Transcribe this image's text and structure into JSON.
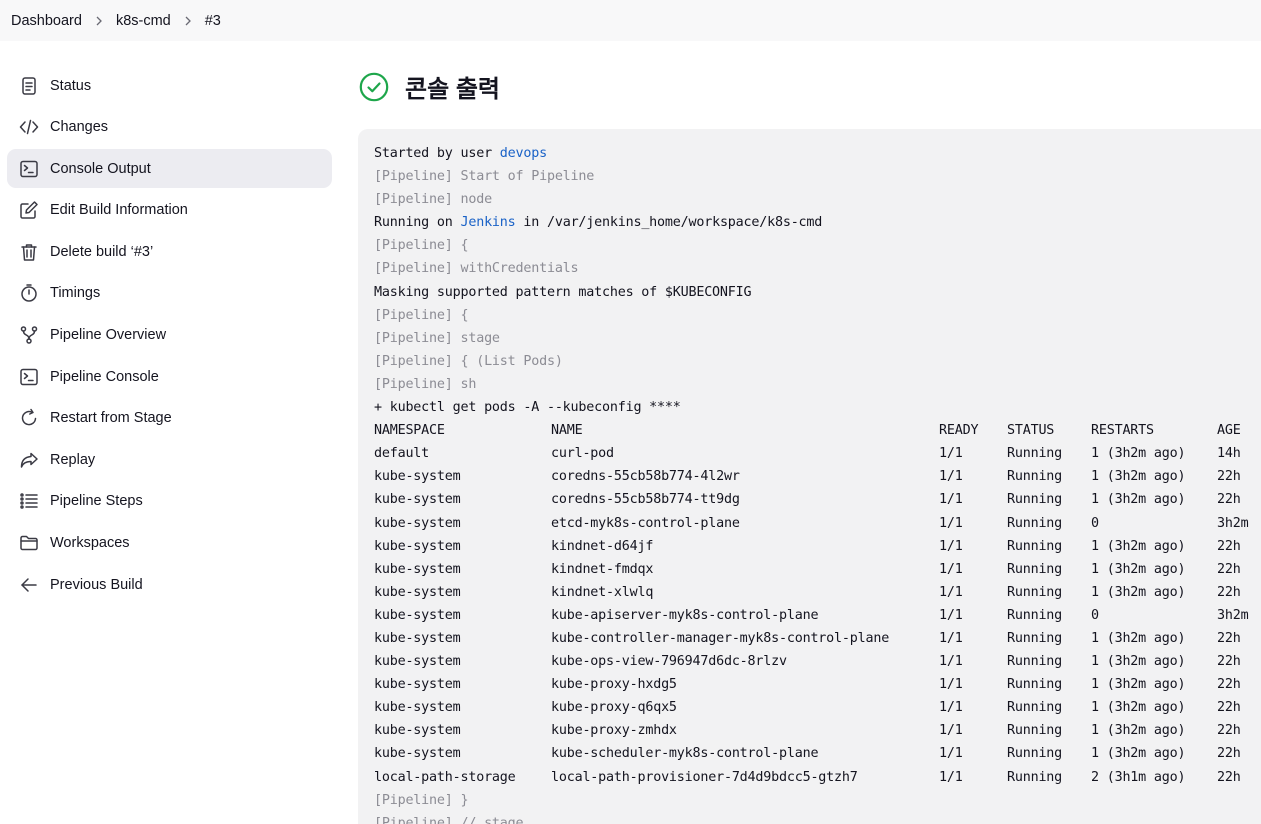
{
  "breadcrumb": [
    "Dashboard",
    "k8s-cmd",
    "#3"
  ],
  "sidebar": {
    "items": [
      {
        "label": "Status",
        "icon": "document-icon"
      },
      {
        "label": "Changes",
        "icon": "code-icon"
      },
      {
        "label": "Console Output",
        "icon": "terminal-icon",
        "active": true
      },
      {
        "label": "Edit Build Information",
        "icon": "edit-icon"
      },
      {
        "label": "Delete build ‘#3’",
        "icon": "trash-icon"
      },
      {
        "label": "Timings",
        "icon": "stopwatch-icon"
      },
      {
        "label": "Pipeline Overview",
        "icon": "pipeline-icon"
      },
      {
        "label": "Pipeline Console",
        "icon": "terminal-icon"
      },
      {
        "label": "Restart from Stage",
        "icon": "restart-icon"
      },
      {
        "label": "Replay",
        "icon": "replay-icon"
      },
      {
        "label": "Pipeline Steps",
        "icon": "list-icon"
      },
      {
        "label": "Workspaces",
        "icon": "folder-icon"
      },
      {
        "label": "Previous Build",
        "icon": "arrow-left-icon"
      }
    ]
  },
  "page": {
    "title": "콘솔 출력",
    "status_icon": "success-check-icon",
    "status_color": "#1ea64b"
  },
  "console": {
    "started_prefix": "Started by user ",
    "started_user": "devops",
    "pre_lines": [
      "[Pipeline] Start of Pipeline",
      "[Pipeline] node"
    ],
    "running_prefix": "Running on ",
    "running_node": "Jenkins",
    "running_suffix": " in /var/jenkins_home/workspace/k8s-cmd",
    "lines_a": [
      "[Pipeline] {",
      "[Pipeline] withCredentials",
      "Masking supported pattern matches of $KUBECONFIG",
      "[Pipeline] {",
      "[Pipeline] stage",
      "[Pipeline] { (List Pods)",
      "[Pipeline] sh",
      "+ kubectl get pods -A --kubeconfig ****"
    ],
    "table_header": [
      "NAMESPACE",
      "NAME",
      "READY",
      "STATUS",
      "RESTARTS",
      "AGE"
    ],
    "pods": [
      [
        "default",
        "curl-pod",
        "1/1",
        "Running",
        "1 (3h2m ago)",
        "14h"
      ],
      [
        "kube-system",
        "coredns-55cb58b774-4l2wr",
        "1/1",
        "Running",
        "1 (3h2m ago)",
        "22h"
      ],
      [
        "kube-system",
        "coredns-55cb58b774-tt9dg",
        "1/1",
        "Running",
        "1 (3h2m ago)",
        "22h"
      ],
      [
        "kube-system",
        "etcd-myk8s-control-plane",
        "1/1",
        "Running",
        "0",
        "3h2m"
      ],
      [
        "kube-system",
        "kindnet-d64jf",
        "1/1",
        "Running",
        "1 (3h2m ago)",
        "22h"
      ],
      [
        "kube-system",
        "kindnet-fmdqx",
        "1/1",
        "Running",
        "1 (3h2m ago)",
        "22h"
      ],
      [
        "kube-system",
        "kindnet-xlwlq",
        "1/1",
        "Running",
        "1 (3h2m ago)",
        "22h"
      ],
      [
        "kube-system",
        "kube-apiserver-myk8s-control-plane",
        "1/1",
        "Running",
        "0",
        "3h2m"
      ],
      [
        "kube-system",
        "kube-controller-manager-myk8s-control-plane",
        "1/1",
        "Running",
        "1 (3h2m ago)",
        "22h"
      ],
      [
        "kube-system",
        "kube-ops-view-796947d6dc-8rlzv",
        "1/1",
        "Running",
        "1 (3h2m ago)",
        "22h"
      ],
      [
        "kube-system",
        "kube-proxy-hxdg5",
        "1/1",
        "Running",
        "1 (3h2m ago)",
        "22h"
      ],
      [
        "kube-system",
        "kube-proxy-q6qx5",
        "1/1",
        "Running",
        "1 (3h2m ago)",
        "22h"
      ],
      [
        "kube-system",
        "kube-proxy-zmhdx",
        "1/1",
        "Running",
        "1 (3h2m ago)",
        "22h"
      ],
      [
        "kube-system",
        "kube-scheduler-myk8s-control-plane",
        "1/1",
        "Running",
        "1 (3h2m ago)",
        "22h"
      ],
      [
        "local-path-storage",
        "local-path-provisioner-7d4d9bdcc5-gtzh7",
        "1/1",
        "Running",
        "2 (3h1m ago)",
        "22h"
      ]
    ],
    "post_lines": [
      "[Pipeline] }",
      "[Pipeline] // stage"
    ]
  }
}
